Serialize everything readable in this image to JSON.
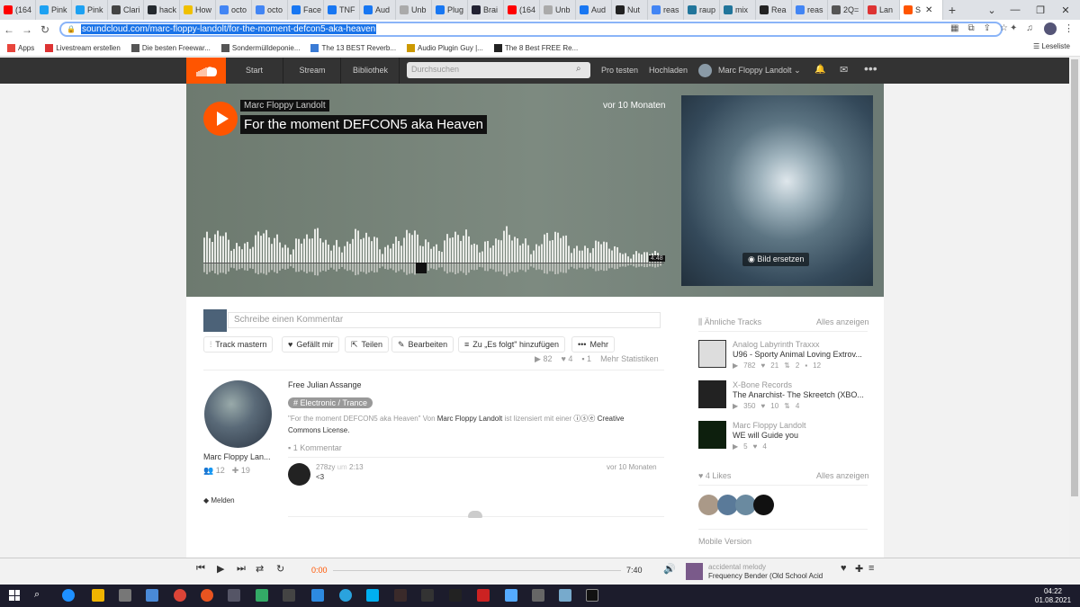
{
  "browser": {
    "tabs": [
      {
        "label": "(164",
        "color": "#ff0000"
      },
      {
        "label": "Pink",
        "color": "#1da1f2"
      },
      {
        "label": "Pink",
        "color": "#1da1f2"
      },
      {
        "label": "Clari",
        "color": "#444"
      },
      {
        "label": "hack",
        "color": "#24292e"
      },
      {
        "label": "How",
        "color": "#f0c000"
      },
      {
        "label": "octo",
        "color": "#4285f4"
      },
      {
        "label": "octo",
        "color": "#4285f4"
      },
      {
        "label": "Face",
        "color": "#1877f2"
      },
      {
        "label": "TNF",
        "color": "#1877f2"
      },
      {
        "label": "Aud",
        "color": "#1877f2"
      },
      {
        "label": "Unb",
        "color": "#aaa"
      },
      {
        "label": "Plug",
        "color": "#1877f2"
      },
      {
        "label": "Brai",
        "color": "#223"
      },
      {
        "label": "(164",
        "color": "#ff0000"
      },
      {
        "label": "Unb",
        "color": "#aaa"
      },
      {
        "label": "Aud",
        "color": "#1877f2"
      },
      {
        "label": "Nut",
        "color": "#222"
      },
      {
        "label": "reas",
        "color": "#4285f4"
      },
      {
        "label": "raup",
        "color": "#21759b"
      },
      {
        "label": "mix",
        "color": "#21759b"
      },
      {
        "label": "Rea",
        "color": "#222"
      },
      {
        "label": "reas",
        "color": "#4285f4"
      },
      {
        "label": "2Q=",
        "color": "#555"
      },
      {
        "label": "Lan",
        "color": "#d33"
      }
    ],
    "active_tab": "S",
    "url": "soundcloud.com/marc-floppy-landolt/for-the-moment-defcon5-aka-heaven",
    "bookmarks": [
      "Apps",
      "Livestream erstellen",
      "Die besten Freewar...",
      "Sondermülldeponie...",
      "The 13 BEST Reverb...",
      "Audio Plugin Guy |...",
      "The 8 Best FREE Re..."
    ],
    "reading_list": "Leseliste"
  },
  "sc_header": {
    "nav": [
      "Start",
      "Stream",
      "Bibliothek"
    ],
    "search_placeholder": "Durchsuchen",
    "pro": "Pro testen",
    "upload": "Hochladen",
    "user": "Marc Floppy Landolt"
  },
  "track": {
    "artist": "Marc Floppy Landolt",
    "title": "For the moment DEFCON5 aka Heaven",
    "posted": "vor 10 Monaten",
    "duration": "4:48",
    "replace_image": "Bild ersetzen",
    "comment_placeholder": "Schreibe einen Kommentar",
    "actions": [
      "Track mastern",
      "Gefällt mir",
      "Teilen",
      "Bearbeiten",
      "Zu „Es folgt\" hinzufügen",
      "Mehr"
    ],
    "plays": "82",
    "likes": "4",
    "comments_count": "1",
    "more_stats": "Mehr Statistiken",
    "description": "Free Julian Assange",
    "tag": "# Electronic / Trance",
    "license_pre": "\"For the moment DEFCON5 aka Heaven\" Von",
    "license_artist": "Marc Floppy Landolt",
    "license_mid": "ist lizensiert mit einer",
    "license_end": "Creative Commons License.",
    "comments_header": "1 Kommentar",
    "uploader_name": "Marc Floppy Lan...",
    "followers": "12",
    "following": "19",
    "report": "Melden",
    "comment": {
      "user": "278zy",
      "at": "um",
      "time": "2:13",
      "text": "<3",
      "date": "vor 10 Monaten"
    }
  },
  "sidebar": {
    "related_title": "Ähnliche Tracks",
    "see_all": "Alles anzeigen",
    "related": [
      {
        "artist": "Analog Labyrinth Traxxx",
        "title": "U96 - Sporty Animal Loving Extrov...",
        "plays": "782",
        "likes": "21",
        "reposts": "2",
        "comments": "12"
      },
      {
        "artist": "X-Bone Records",
        "title": "The Anarchist- The Skreetch  (XBO...",
        "plays": "350",
        "likes": "10",
        "reposts": "4",
        "comments": ""
      },
      {
        "artist": "Marc Floppy Landolt",
        "title": "WE will Guide you",
        "plays": "5",
        "likes": "4",
        "reposts": "",
        "comments": ""
      }
    ],
    "likes_title": "4 Likes",
    "likes_see_all": "Alles anzeigen",
    "mobile": "Mobile Version"
  },
  "player": {
    "elapsed": "0:00",
    "total": "7:40",
    "now_artist": "accidental melody",
    "now_title": "Frequency Bender (Old School Acid ..."
  },
  "taskbar": {
    "time": "04:22",
    "date": "01.08.2021"
  },
  "colors": {
    "accent": "#ff5500",
    "header": "#333333"
  }
}
